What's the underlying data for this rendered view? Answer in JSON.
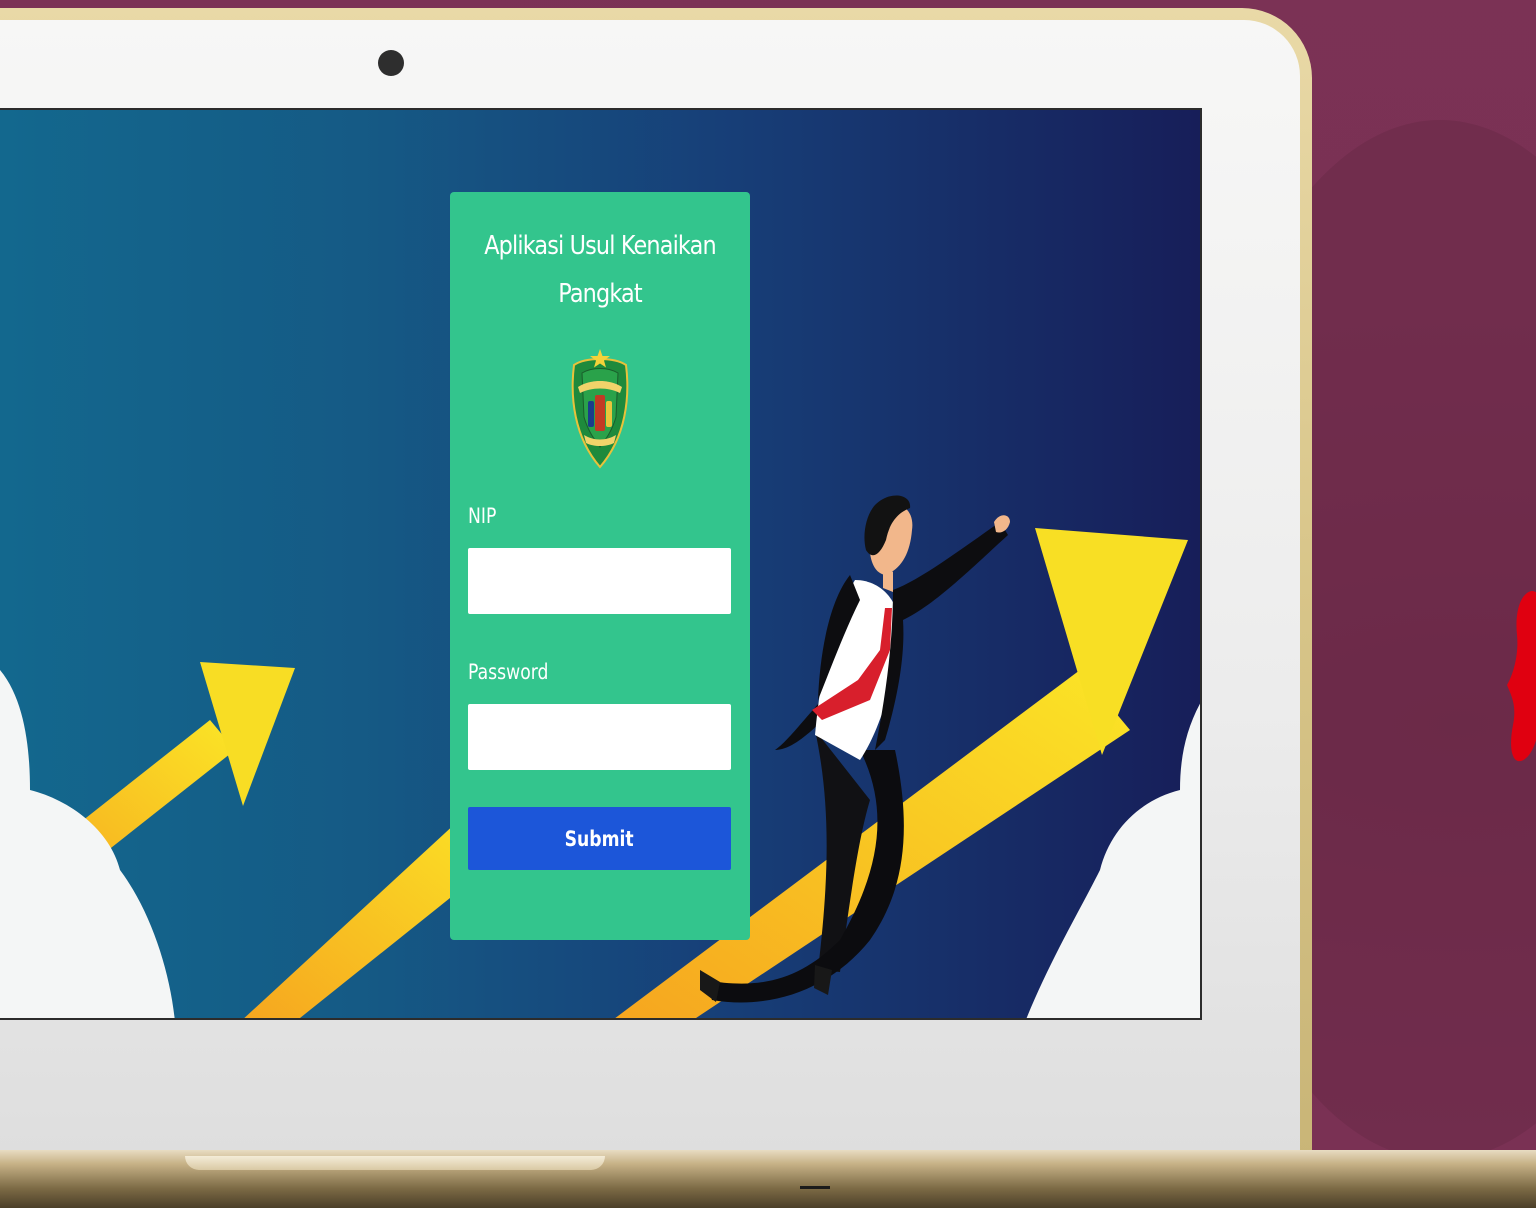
{
  "login_form": {
    "title_line1": "Aplikasi Usul Kenaikan",
    "title_line2": "Pangkat",
    "emblem_icon": "government-emblem-icon",
    "nip_label": "NIP",
    "nip_value": "",
    "password_label": "Password",
    "password_value": "",
    "submit_label": "Submit"
  },
  "colors": {
    "page_background": "#7a3154",
    "card": "#33c58d",
    "submit_button": "#1c56d9",
    "screen_gradient_start": "#13688e",
    "screen_gradient_end": "#171e59",
    "arrow_yellow": "#f9d62b",
    "laptop_frame": "#d8c589"
  }
}
